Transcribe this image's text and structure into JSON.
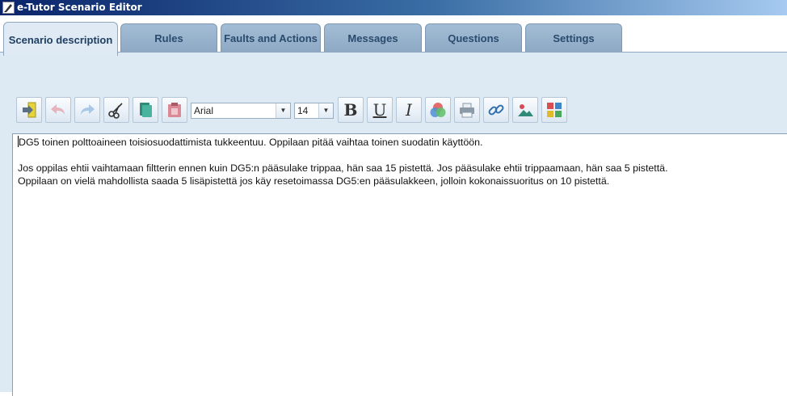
{
  "window": {
    "title": "e-Tutor Scenario Editor"
  },
  "tabs": [
    {
      "label": "Scenario description",
      "active": true
    },
    {
      "label": "Rules"
    },
    {
      "label": "Faults and Actions"
    },
    {
      "label": "Messages"
    },
    {
      "label": "Questions"
    },
    {
      "label": "Settings"
    }
  ],
  "toolbar": {
    "font_family": "Arial",
    "font_size": "14",
    "bold_label": "B",
    "underline_label": "U",
    "italic_label": "I",
    "icons": [
      "insert-icon",
      "undo-icon",
      "redo-icon",
      "cut-icon",
      "copy-icon",
      "paste-icon",
      "color-icon",
      "print-icon",
      "link-icon",
      "image-icon",
      "symbols-icon"
    ]
  },
  "editor": {
    "paragraphs": [
      "DG5 toinen polttoaineen toisiosuodattimista tukkeentuu. Oppilaan pitää vaihtaa toinen suodatin käyttöön.",
      "Jos oppilas ehtii vaihtamaan filtterin ennen kuin DG5:n pääsulake trippaa, hän saa 15 pistettä. Jos pääsulake ehtii trippaamaan, hän saa 5 pistettä.",
      "Oppilaan on vielä mahdollista saada 5 lisäpistettä jos käy resetoimassa DG5:en pääsulakkeen, jolloin kokonaissuoritus on 10 pistettä."
    ]
  },
  "colors": {
    "titlebar_start": "#0a246a",
    "panel_bg": "#dde9f3",
    "tab_inactive": "#a3bdd6",
    "tab_active": "#dfeaf4"
  }
}
